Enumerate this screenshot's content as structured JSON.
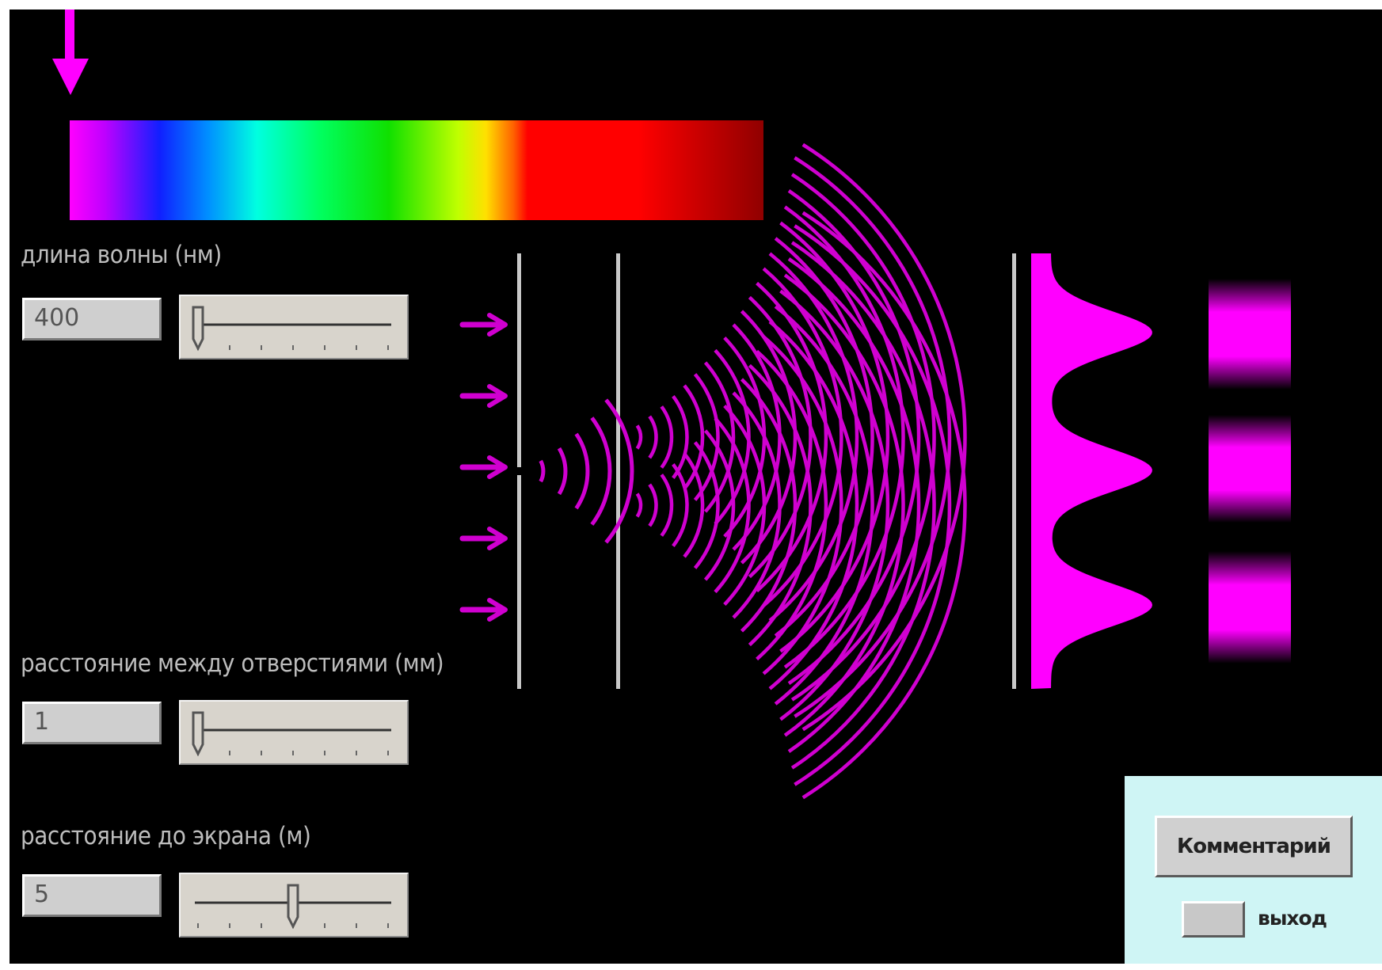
{
  "wavelength": {
    "label": "длина волны (нм)",
    "value": "400",
    "slider_fraction": 0.0
  },
  "slit_distance": {
    "label": "расстояние между отверстиями (мм)",
    "value": "1",
    "slider_fraction": 0.0
  },
  "screen_distance": {
    "label": "расстояние до экрана (м)",
    "value": "5",
    "slider_fraction": 0.5
  },
  "panel": {
    "comment_label": "Комментарий",
    "exit_label": "выход"
  },
  "colors": {
    "background": "#000000",
    "wave": "#d000d0",
    "pattern": "#ff00ff",
    "barrier": "#c8c8c8",
    "label": "#bdbdbd",
    "panel_bg": "#cff5f5"
  },
  "icons": {
    "pointer": "down-arrow-icon",
    "incident": "right-arrow-icon"
  }
}
